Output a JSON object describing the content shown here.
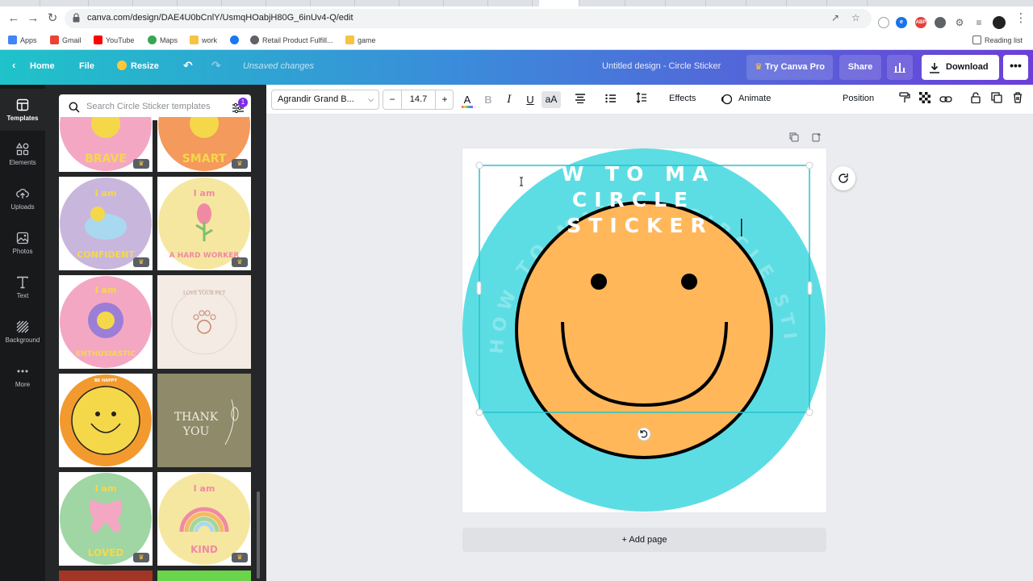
{
  "browser": {
    "url": "canva.com/design/DAE4U0bCnlY/UsmqHOabjH80G_6inUv4-Q/edit",
    "bookmarks": [
      {
        "label": "Apps",
        "icon": "apps-grid-icon",
        "color": "#4285f4"
      },
      {
        "label": "Gmail",
        "icon": "gmail-icon",
        "color": "#ea4335"
      },
      {
        "label": "YouTube",
        "icon": "youtube-icon",
        "color": "#ff0000"
      },
      {
        "label": "Maps",
        "icon": "maps-pin-icon",
        "color": "#34a853"
      },
      {
        "label": "work",
        "icon": "folder-icon",
        "color": "#f6c343"
      },
      {
        "label": "",
        "icon": "facebook-icon",
        "color": "#1877f2"
      },
      {
        "label": "Retail Product Fulfill...",
        "icon": "globe-icon",
        "color": "#5f6368"
      },
      {
        "label": "game",
        "icon": "folder-icon",
        "color": "#f6c343"
      }
    ],
    "reading_list": "Reading list",
    "extension_badge": "ABP"
  },
  "topbar": {
    "home": "Home",
    "file": "File",
    "resize": "Resize",
    "status": "Unsaved changes",
    "design_title": "Untitled design - Circle Sticker",
    "try_pro": "Try Canva Pro",
    "share": "Share",
    "download": "Download",
    "more": "•••"
  },
  "rail": [
    {
      "label": "Templates",
      "icon": "templates-icon",
      "active": true
    },
    {
      "label": "Elements",
      "icon": "elements-icon",
      "active": false
    },
    {
      "label": "Uploads",
      "icon": "uploads-cloud-icon",
      "active": false
    },
    {
      "label": "Photos",
      "icon": "photos-icon",
      "active": false
    },
    {
      "label": "Text",
      "icon": "text-icon",
      "active": false
    },
    {
      "label": "Background",
      "icon": "background-icon",
      "active": false
    },
    {
      "label": "More",
      "icon": "more-dots-icon",
      "active": false
    }
  ],
  "panel": {
    "search_placeholder": "Search Circle Sticker templates",
    "filter_badge": "1",
    "templates": [
      {
        "name": "brave",
        "line1": "",
        "line2": "BRAVE",
        "bg": "#f4a7c3",
        "text_color": "#f5d84a"
      },
      {
        "name": "smart",
        "line1": "",
        "line2": "SMART",
        "bg": "#f39a5c",
        "text_color": "#f5d84a"
      },
      {
        "name": "confident",
        "line1": "I am",
        "line2": "CONFIDENT",
        "bg": "#c9b6dd",
        "text_color": "#f5d84a"
      },
      {
        "name": "hard-worker",
        "line1": "I am",
        "line2": "A HARD WORKER",
        "bg": "#f6e7a0",
        "text_color": "#f08aa4"
      },
      {
        "name": "enthusiastic",
        "line1": "I am",
        "line2": "ENTHUSIASTIC",
        "bg": "#f4a7c3",
        "text_color": "#f5d84a"
      },
      {
        "name": "love-your-pet",
        "line1": "LOVE YOUR PET",
        "line2": "",
        "bg": "#f3ebe4",
        "text_color": "#c39b87"
      },
      {
        "name": "be-happy",
        "line1": "BE HAPPY",
        "line2": "",
        "bg": "#f39a2e",
        "text_color": "#ffffff"
      },
      {
        "name": "thank-you",
        "line1": "THANK",
        "line2": "YOU",
        "bg": "#8e8a6a",
        "text_color": "#f0ece0"
      },
      {
        "name": "loved",
        "line1": "I am",
        "line2": "LOVED",
        "bg": "#9fd6a3",
        "text_color": "#f5d84a"
      },
      {
        "name": "kind",
        "line1": "I am",
        "line2": "KIND",
        "bg": "#f6e7a0",
        "text_color": "#f08aa4"
      }
    ]
  },
  "toolbar": {
    "font": "Agrandir Grand B...",
    "size_minus": "−",
    "size": "14.7",
    "size_plus": "+",
    "text_color_glyph": "A",
    "bold": "B",
    "italic": "I",
    "underline": "U",
    "case": "aA",
    "effects": "Effects",
    "animate": "Animate",
    "position": "Position"
  },
  "canvas": {
    "curved_text": "HOW TO MAKE A CIRCLE STICKER",
    "line1": "W TO MA",
    "line2": "CIRCLE",
    "line3": "STICKER",
    "add_page": "+ Add page",
    "colors": {
      "circle": "#5cdde4",
      "smiley": "#ffb75a",
      "outline": "#000000",
      "selection": "#27c4cc"
    }
  }
}
